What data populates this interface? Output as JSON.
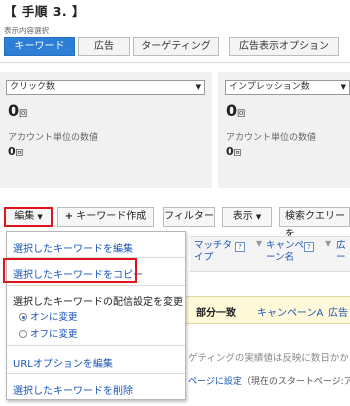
{
  "step_title": "【 手順 3. 】",
  "display_selection": {
    "label": "表示内容選択",
    "tabs": [
      {
        "label": "キーワード",
        "active": true
      },
      {
        "label": "広告"
      },
      {
        "label": "ターゲティング"
      },
      {
        "label": "広告表示オプション"
      }
    ]
  },
  "metrics": [
    {
      "dropdown": "クリック数",
      "value": "0",
      "unit": "回",
      "sub_label": "アカウント単位の数値",
      "sub_value": "0",
      "sub_unit": "回"
    },
    {
      "dropdown": "インプレッション数",
      "value": "0",
      "unit": "回",
      "sub_label": "アカウント単位の数値",
      "sub_value": "0",
      "sub_unit": "回"
    }
  ],
  "toolbar": {
    "edit": "編集",
    "create_keyword": "キーワード作成",
    "filter": "フィルター",
    "display": "表示",
    "search_query": "検索クエリーを"
  },
  "grid": {
    "col_match": "マッチタ\nイプ",
    "col_campaign": "キャンペ\nーン名",
    "col_ad": "広\nー",
    "row_match": "部分一致",
    "row_campaign": "キャンペーンA",
    "row_ad": "広告",
    "note": "ゲティングの実績値は反映に数日かか",
    "link_text": "ページに設定",
    "link_rest": "（現在のスタートページ:ア"
  },
  "edit_menu": {
    "edit_keywords": "選択したキーワードを編集",
    "copy_keywords": "選択したキーワードをコピー",
    "delivery_header": "選択したキーワードの配信設定を変更",
    "on": "オンに変更",
    "off": "オフに変更",
    "url_options": "URLオプションを編集",
    "delete_keywords": "選択したキーワードを削除"
  },
  "colors": {
    "accent": "#2d7fd6",
    "highlight_red": "#e1141e",
    "link_blue": "#1b55b8"
  }
}
